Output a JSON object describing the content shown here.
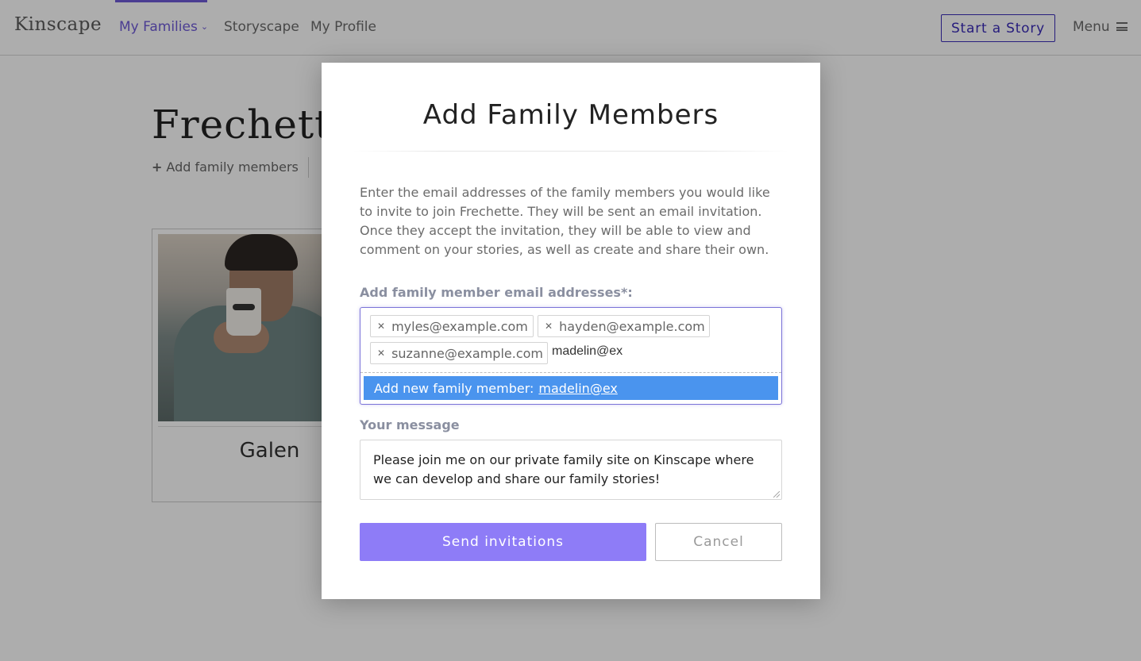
{
  "nav": {
    "logo": "Kinscape",
    "my_families": "My Families",
    "storyscape": "Storyscape",
    "my_profile": "My Profile",
    "start_story": "Start a Story",
    "menu": "Menu",
    "accent_color": "#6f5bd8"
  },
  "page": {
    "family_title": "Frechette",
    "add_family_members_link": "Add family members",
    "member_name": "Galen"
  },
  "modal": {
    "title": "Add Family Members",
    "description": "Enter the email addresses of the family members you would like to invite to join Frechette. They will be sent an email invitation. Once they accept the invitation, they will be able to view and comment on your stories, as well as create and share their own.",
    "emails_label": "Add family member email addresses*:",
    "email_tags": [
      "myles@example.com",
      "hayden@example.com",
      "suzanne@example.com"
    ],
    "typed_value": "madelin@ex",
    "dropdown_prefix": "Add new family member:",
    "dropdown_value": "madelin@ex",
    "message_label": "Your message",
    "message_value": "Please join me on our private family site on Kinscape where we can develop and share our family stories!",
    "send_button": "Send invitations",
    "cancel_button": "Cancel",
    "send_color": "#8e7cf7",
    "highlight_color": "#4a94ee"
  }
}
